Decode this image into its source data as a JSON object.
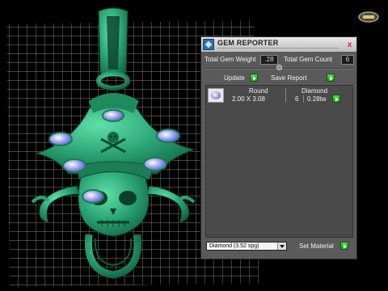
{
  "panel": {
    "title": "GEM REPORTER",
    "close_glyph": "x",
    "total_weight_label": "Total Gem Weight",
    "total_weight_value": ".28",
    "total_count_label": "Total Gem Count",
    "total_count_value": "6",
    "update_label": "Update",
    "save_report_label": "Save Report",
    "report": {
      "shape": "Round",
      "size": "2.00 X 3.08",
      "gem_type": "Diamond",
      "count": "6",
      "weight": "0.28tw"
    },
    "material_selected": "Diamond   (3.52 spg)",
    "set_material_label": "Set Material"
  },
  "colors": {
    "metal": "#2aa374",
    "gem": "#8a90e8",
    "panel_bg": "#5a5a5a",
    "button_green": "#2fbf2f",
    "grid": "#bfbfbf"
  },
  "icons": {
    "app": "gem-reporter-app-icon",
    "close": "close-icon",
    "nav": "navigation-logo-icon",
    "gem_thumbnail": "round-gem-icon"
  }
}
